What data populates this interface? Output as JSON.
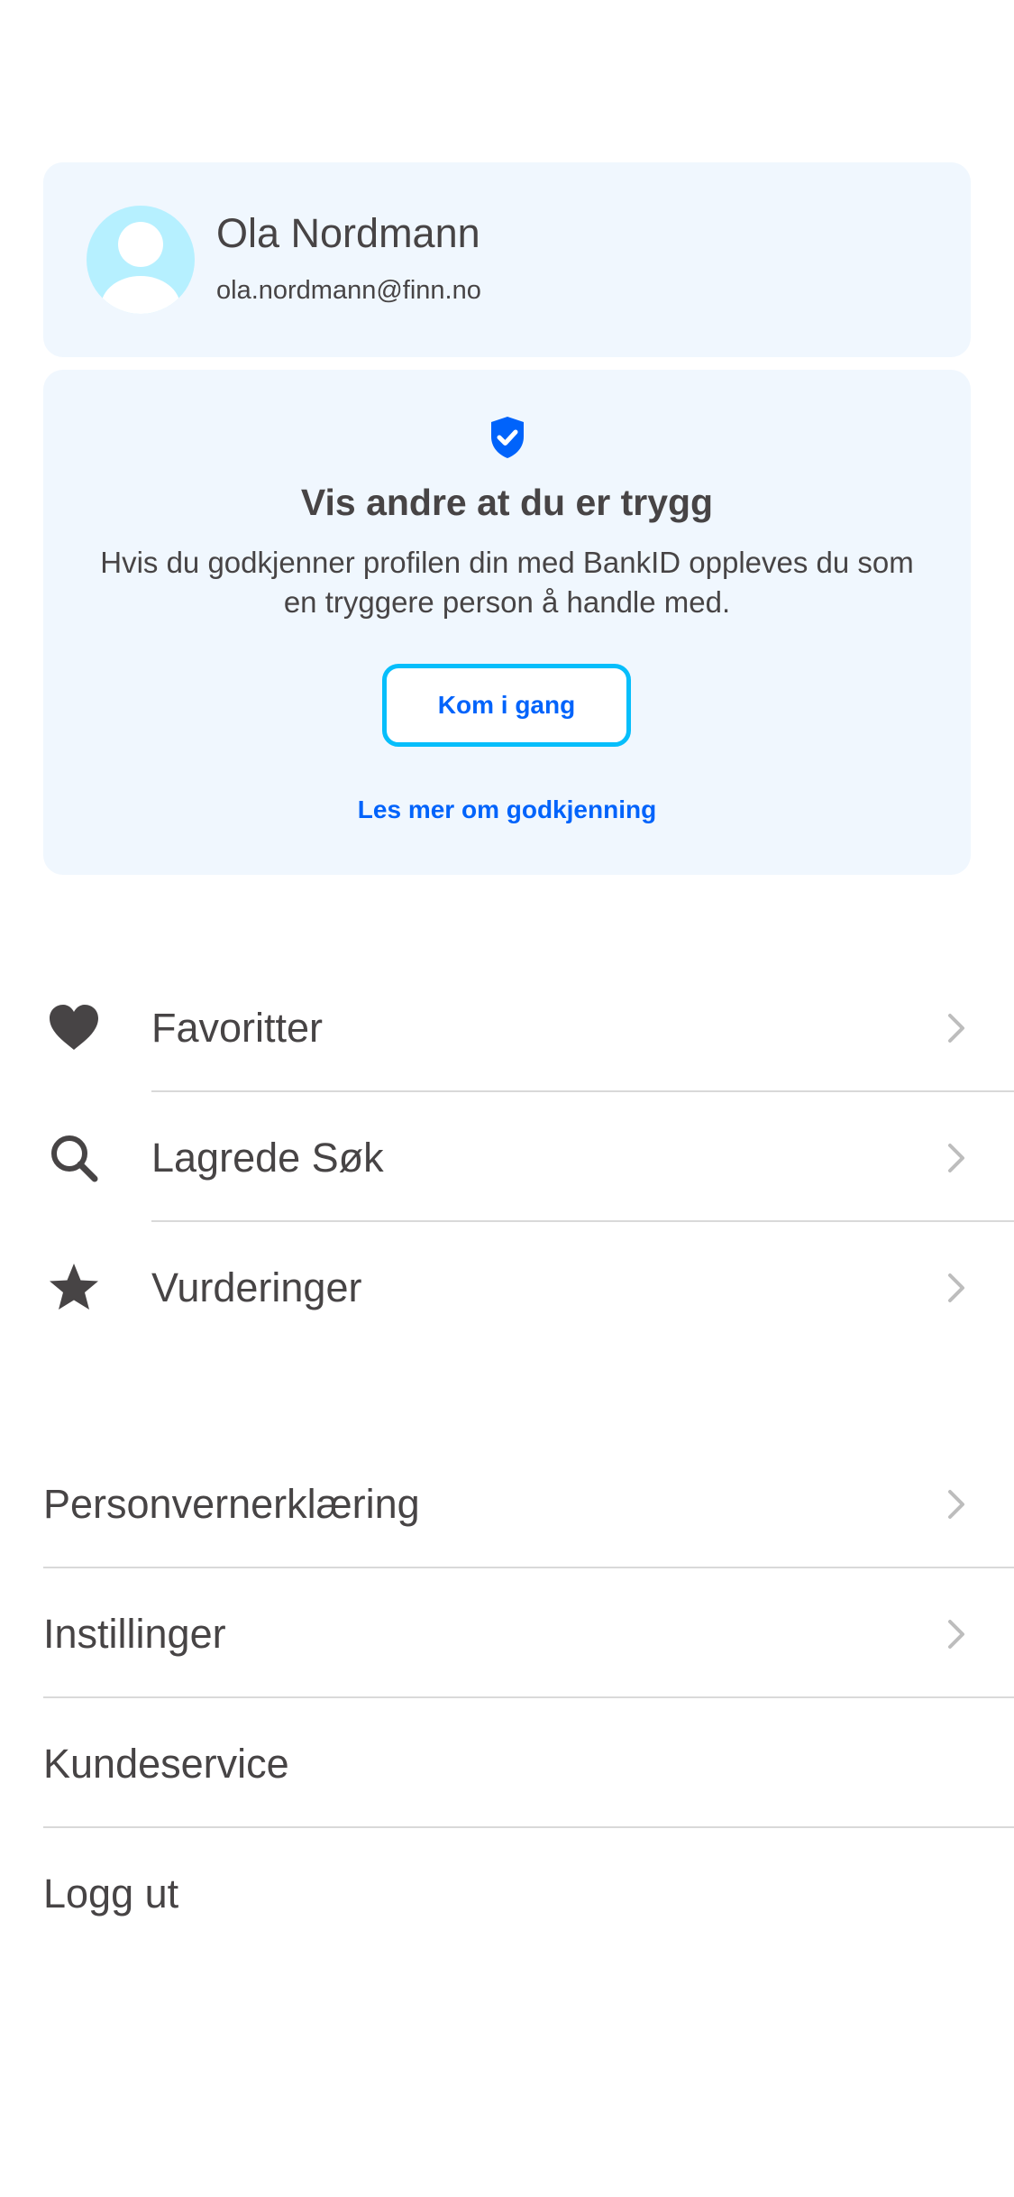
{
  "profile": {
    "name": "Ola Nordmann",
    "email": "ola.nordmann@finn.no",
    "avatar_icon": "person-avatar-icon"
  },
  "verification": {
    "icon": "shield-check-icon",
    "title": "Vis andre at du er trygg",
    "text": "Hvis du godkjenner profilen din med BankID oppleves du som en tryggere person å handle med.",
    "button_label": "Kom i gang",
    "link_label": "Les mer om godkjenning"
  },
  "menu_primary": [
    {
      "label": "Favoritter",
      "icon": "heart-icon",
      "chevron": true
    },
    {
      "label": "Lagrede Søk",
      "icon": "search-icon",
      "chevron": true
    },
    {
      "label": "Vurderinger",
      "icon": "star-icon",
      "chevron": true
    }
  ],
  "menu_secondary": [
    {
      "label": "Personvernerklæring",
      "chevron": true
    },
    {
      "label": "Instillinger",
      "chevron": true
    },
    {
      "label": "Kundeservice",
      "chevron": false
    },
    {
      "label": "Logg ut",
      "chevron": false
    }
  ],
  "colors": {
    "card_background": "#f0f7fe",
    "avatar_background": "#b6f0ff",
    "accent_blue": "#0063fb",
    "button_border": "#06befb",
    "text": "#474445",
    "chevron": "#bdbdbd",
    "divider": "#d9d9d9"
  }
}
